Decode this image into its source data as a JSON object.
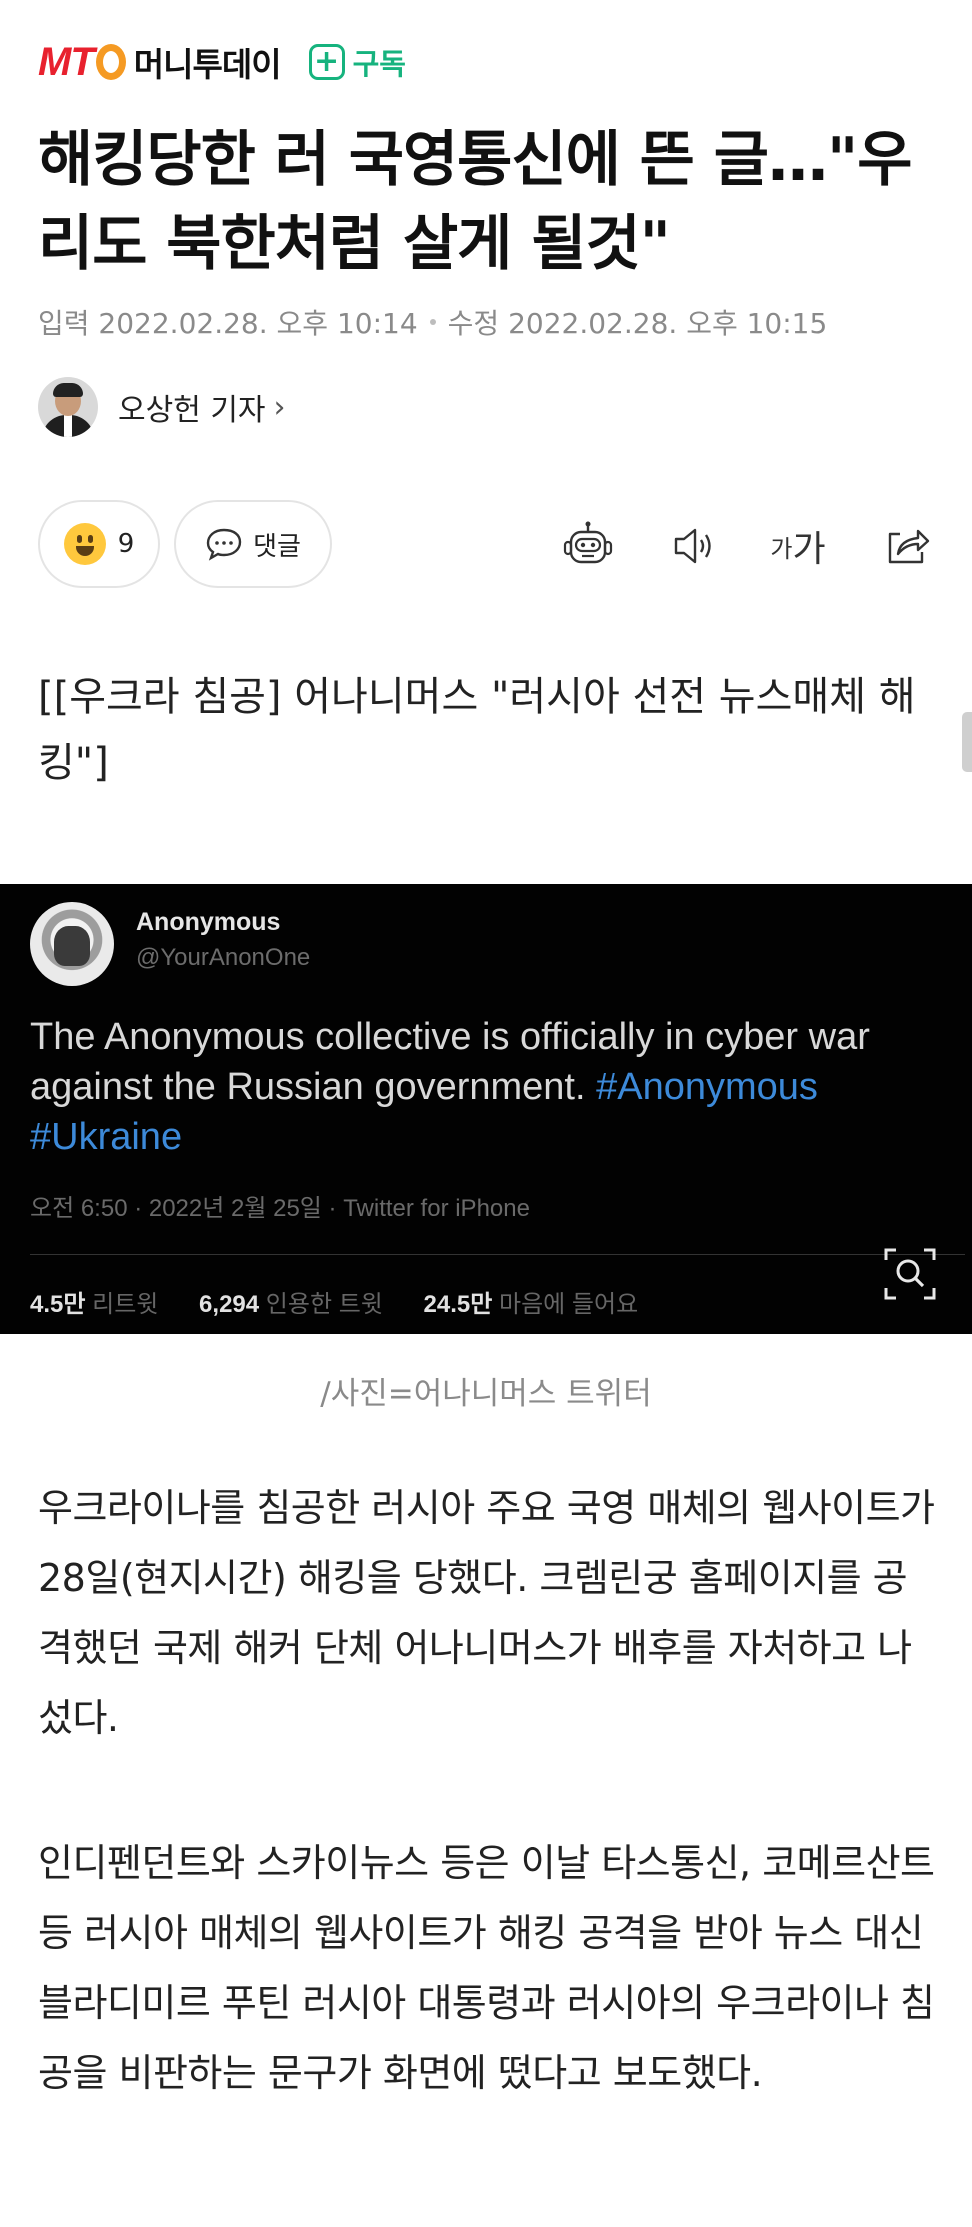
{
  "brand": {
    "logo_text": "MT",
    "name": "머니투데이"
  },
  "subscribe": {
    "label": "구독"
  },
  "article": {
    "headline": "해킹당한 러 국영통신에 뜬 글…\"우리도 북한처럼 살게 될것\"",
    "input_date": "입력 2022.02.28. 오후 10:14",
    "edit_date": "수정 2022.02.28. 오후 10:15",
    "reporter": "오상헌 기자",
    "subtitle": "[[우크라 침공] 어나니머스 \"러시아 선전 뉴스매체 해킹\"]",
    "caption": "/사진=어나니머스 트위터",
    "paragraphs": [
      "우크라이나를 침공한 러시아 주요 국영 매체의 웹사이트가 28일(현지시간) 해킹을 당했다. 크렘린궁 홈페이지를 공격했던 국제 해커 단체 어나니머스가 배후를 자처하고 나섰다.",
      "인디펜던트와 스카이뉴스 등은 이날 타스통신, 코메르산트 등 러시아 매체의 웹사이트가 해킹 공격을 받아 뉴스 대신 블라디미르 푸틴 러시아 대통령과 러시아의 우크라이나 침공을 비판하는 문구가 화면에 떴다고 보도했다."
    ]
  },
  "reactions": {
    "count": "9",
    "comment_label": "댓글"
  },
  "toolbar": {
    "font_small": "가",
    "font_large": "가"
  },
  "tweet": {
    "name": "Anonymous",
    "handle": "@YourAnonOne",
    "text": "The Anonymous collective is officially in cyber war against the Russian government.",
    "hashtag1": "#Anonymous",
    "hashtag2": "#Ukraine",
    "meta": "오전 6:50 · 2022년 2월 25일 · Twitter for iPhone",
    "retweets_value": "4.5만",
    "retweets_label": "리트윗",
    "quotes_value": "6,294",
    "quotes_label": "인용한 트윗",
    "likes_value": "24.5만",
    "likes_label": "마음에 들어요"
  },
  "colors": {
    "brand_red": "#e8212e",
    "brand_orange": "#f59a23",
    "subscribe_green": "#16b37e",
    "hashtag_blue": "#3d8ad9"
  },
  "icons": [
    "plus-icon",
    "emoji-icon",
    "comment-bubble-icon",
    "robot-icon",
    "speaker-icon",
    "font-size-icon",
    "share-icon",
    "zoom-icon"
  ]
}
